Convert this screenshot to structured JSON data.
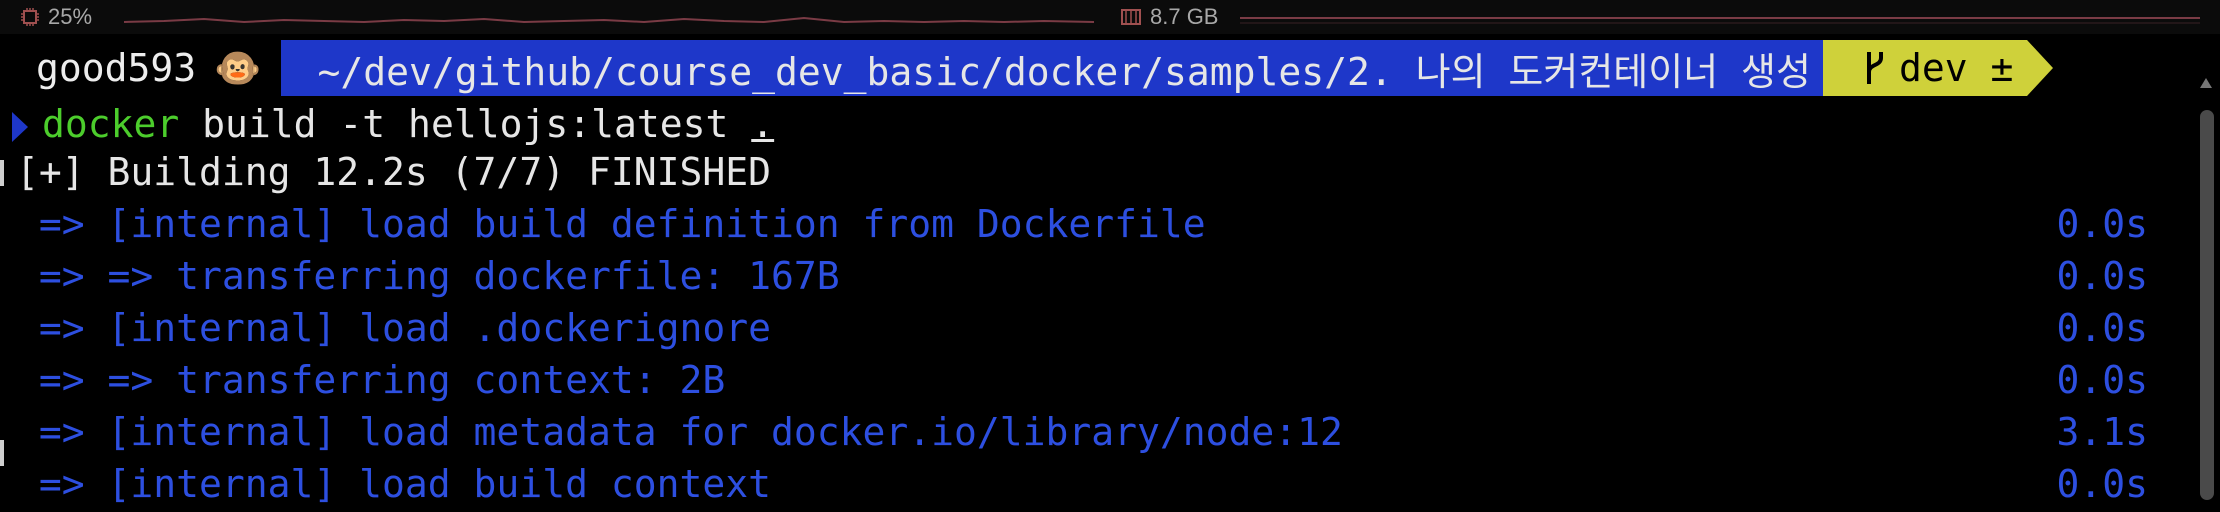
{
  "status": {
    "cpu_label": "25%",
    "mem_label": "8.7 GB",
    "cpu_icon": "cpu-chip-icon",
    "mem_icon": "memory-icon"
  },
  "prompt": {
    "user": "good593",
    "user_emoji": "🐵",
    "path": "~/dev/github/course_dev_basic/docker/samples/2. 나의 도커컨테이너 생성",
    "branch_icon": "git-branch-icon",
    "branch": "dev ±"
  },
  "command": {
    "program": "docker",
    "args": " build -t hellojs:latest ",
    "context": "."
  },
  "summary": "[+] Building 12.2s (7/7) FINISHED",
  "steps": [
    {
      "text": " => [internal] load build definition from Dockerfile",
      "time": "0.0s"
    },
    {
      "text": " => => transferring dockerfile: 167B",
      "time": "0.0s"
    },
    {
      "text": " => [internal] load .dockerignore",
      "time": "0.0s"
    },
    {
      "text": " => => transferring context: 2B",
      "time": "0.0s"
    },
    {
      "text": " => [internal] load metadata for docker.io/library/node:12",
      "time": "3.1s"
    },
    {
      "text": " => [internal] load build context",
      "time": "0.0s"
    }
  ],
  "colors": {
    "path_bg": "#1e37c9",
    "branch_bg": "#cfd13a",
    "step_text": "#2d4fe0",
    "command_green": "#4ccd2c"
  }
}
